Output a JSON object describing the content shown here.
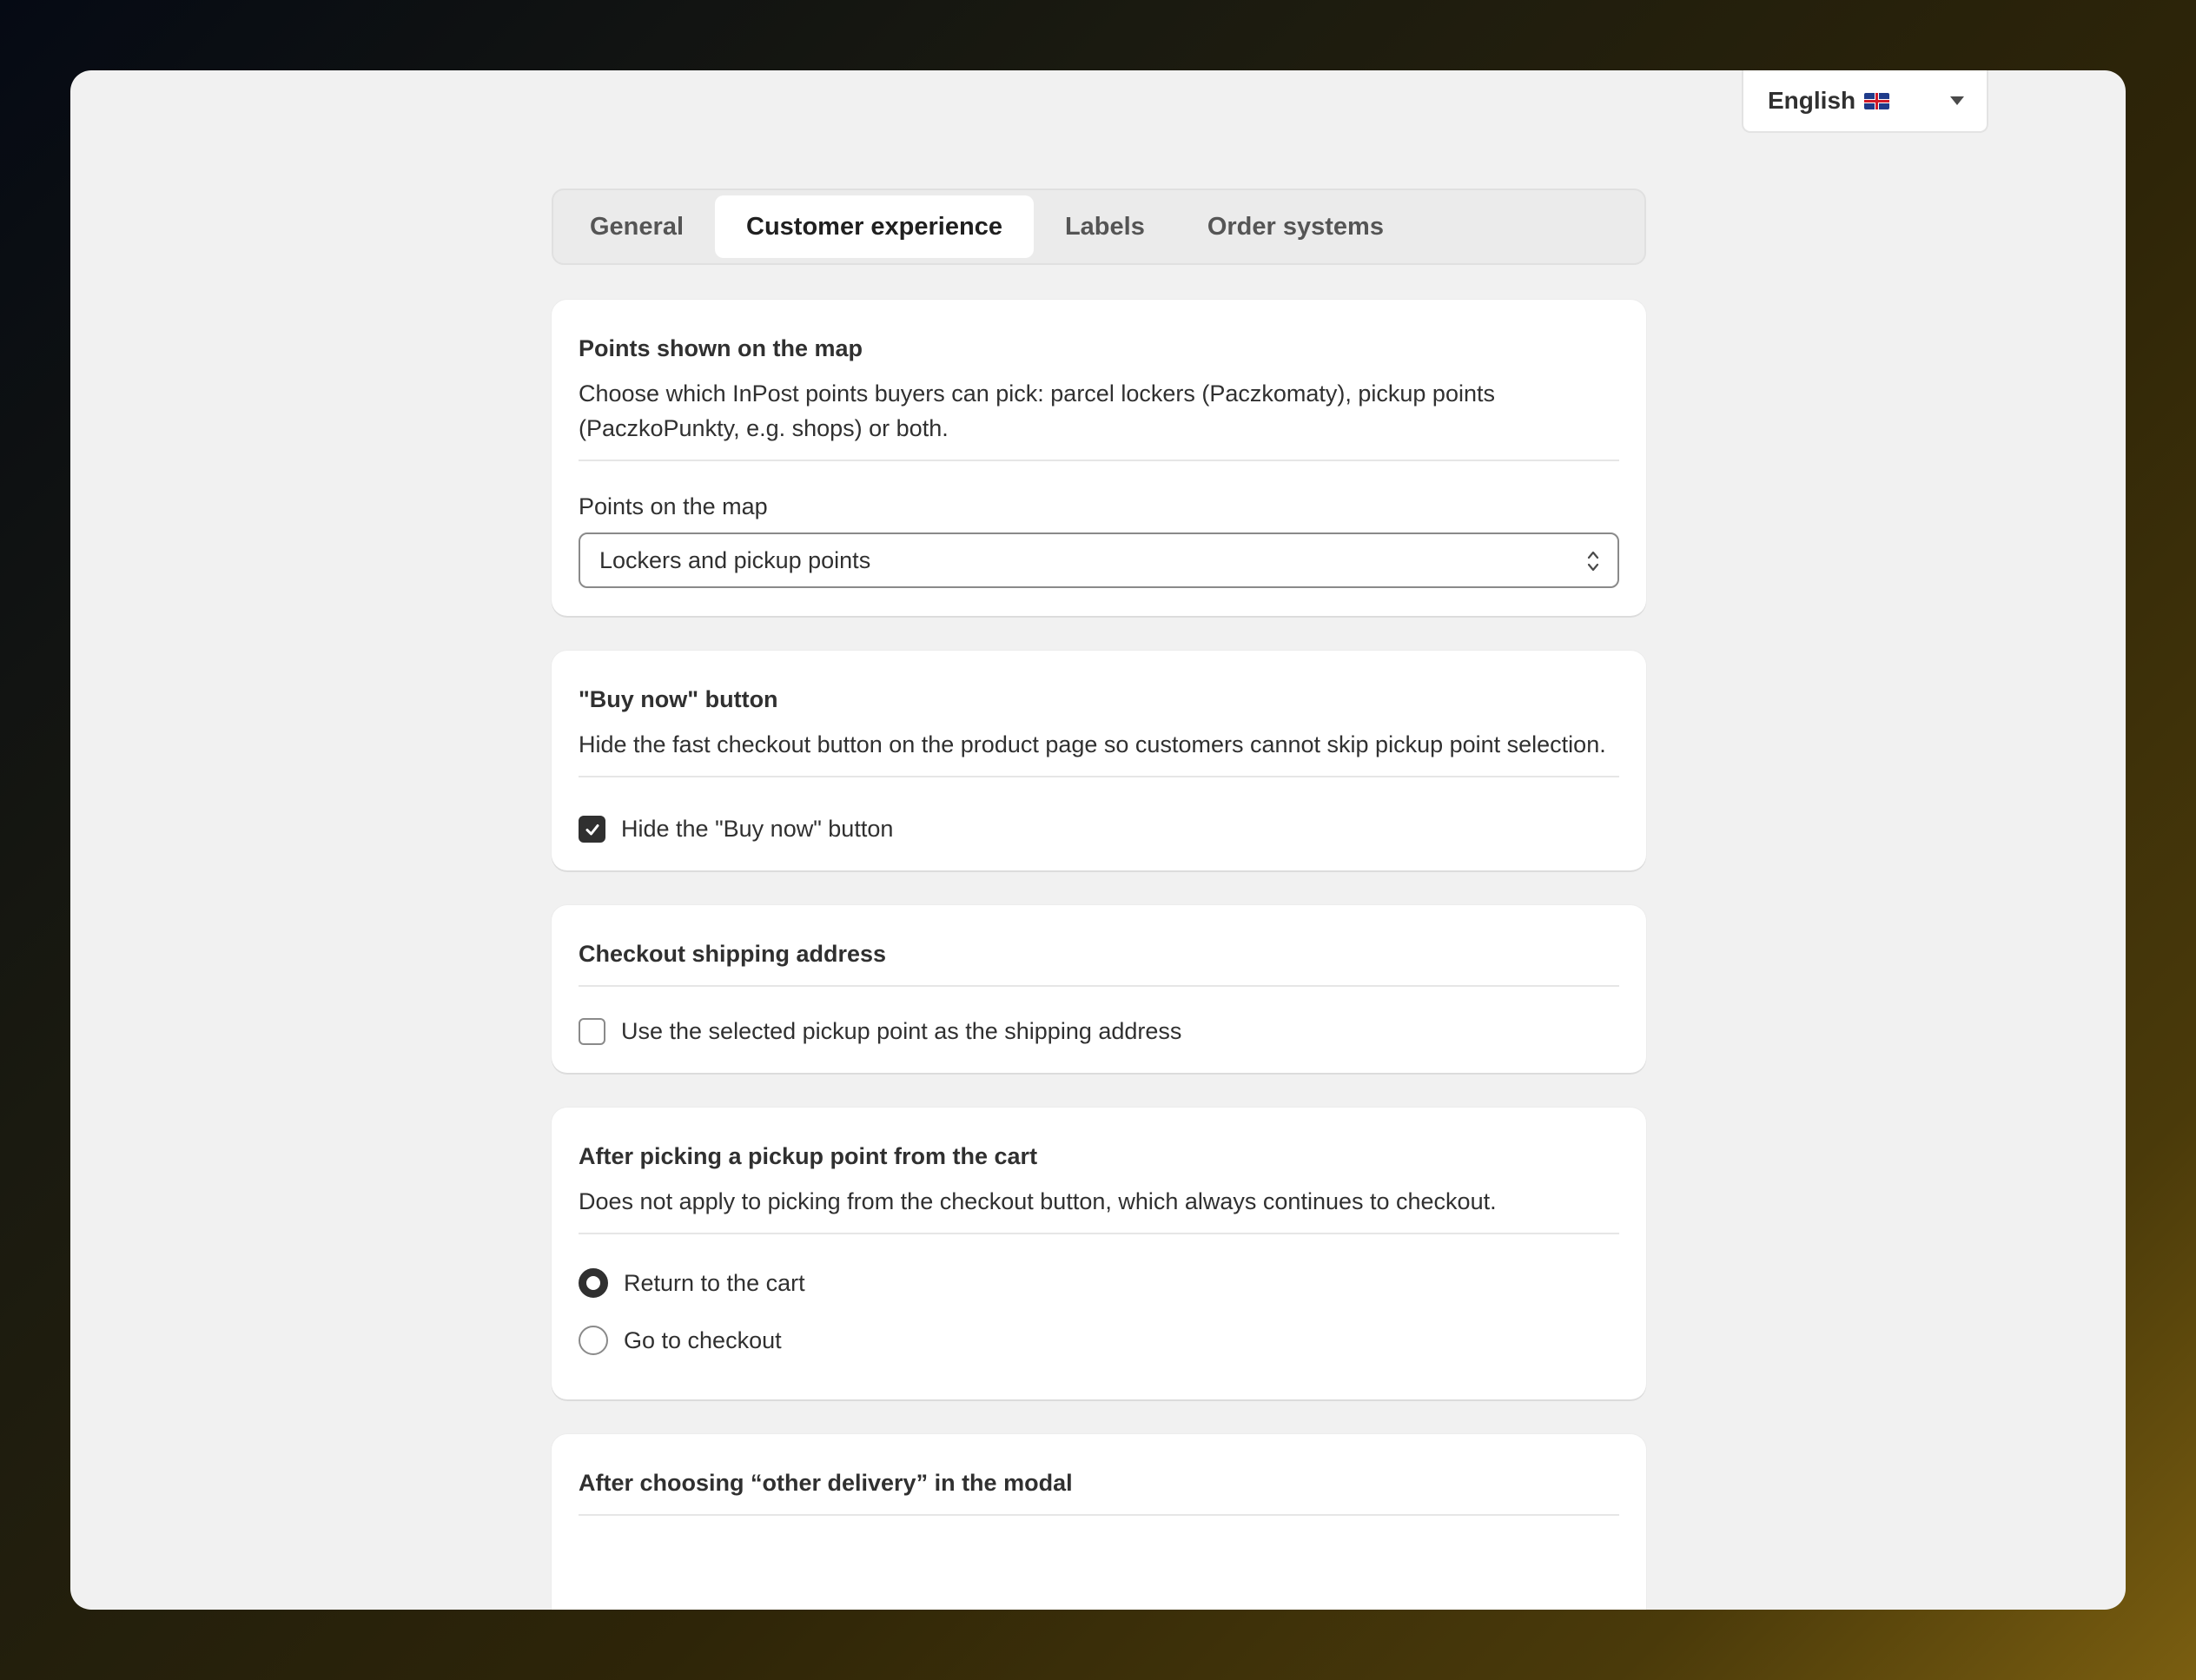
{
  "language": {
    "label": "English",
    "flag_icon": "uk-flag-icon"
  },
  "tabs": [
    {
      "label": "General",
      "active": false
    },
    {
      "label": "Customer experience",
      "active": true
    },
    {
      "label": "Labels",
      "active": false
    },
    {
      "label": "Order systems",
      "active": false
    }
  ],
  "points_card": {
    "title": "Points shown on the map",
    "description": "Choose which InPost points buyers can pick: parcel lockers (Paczkomaty), pickup points (PaczkoPunkty, e.g. shops) or both.",
    "field_label": "Points on the map",
    "selected_value": "Lockers and pickup points"
  },
  "buy_now_card": {
    "title": "\"Buy now\" button",
    "description": "Hide the fast checkout button on the product page so customers cannot skip pickup point selection.",
    "checkbox_label": "Hide the \"Buy now\" button",
    "checked": true
  },
  "shipping_card": {
    "title": "Checkout shipping address",
    "checkbox_label": "Use the selected pickup point as the shipping address",
    "checked": false
  },
  "after_pick_card": {
    "title": "After picking a pickup point from the cart",
    "description": "Does not apply to picking from the checkout button, which always continues to checkout.",
    "options": [
      {
        "label": "Return to the cart",
        "selected": true
      },
      {
        "label": "Go to checkout",
        "selected": false
      }
    ]
  },
  "other_delivery_card": {
    "title": "After choosing “other delivery” in the modal"
  }
}
